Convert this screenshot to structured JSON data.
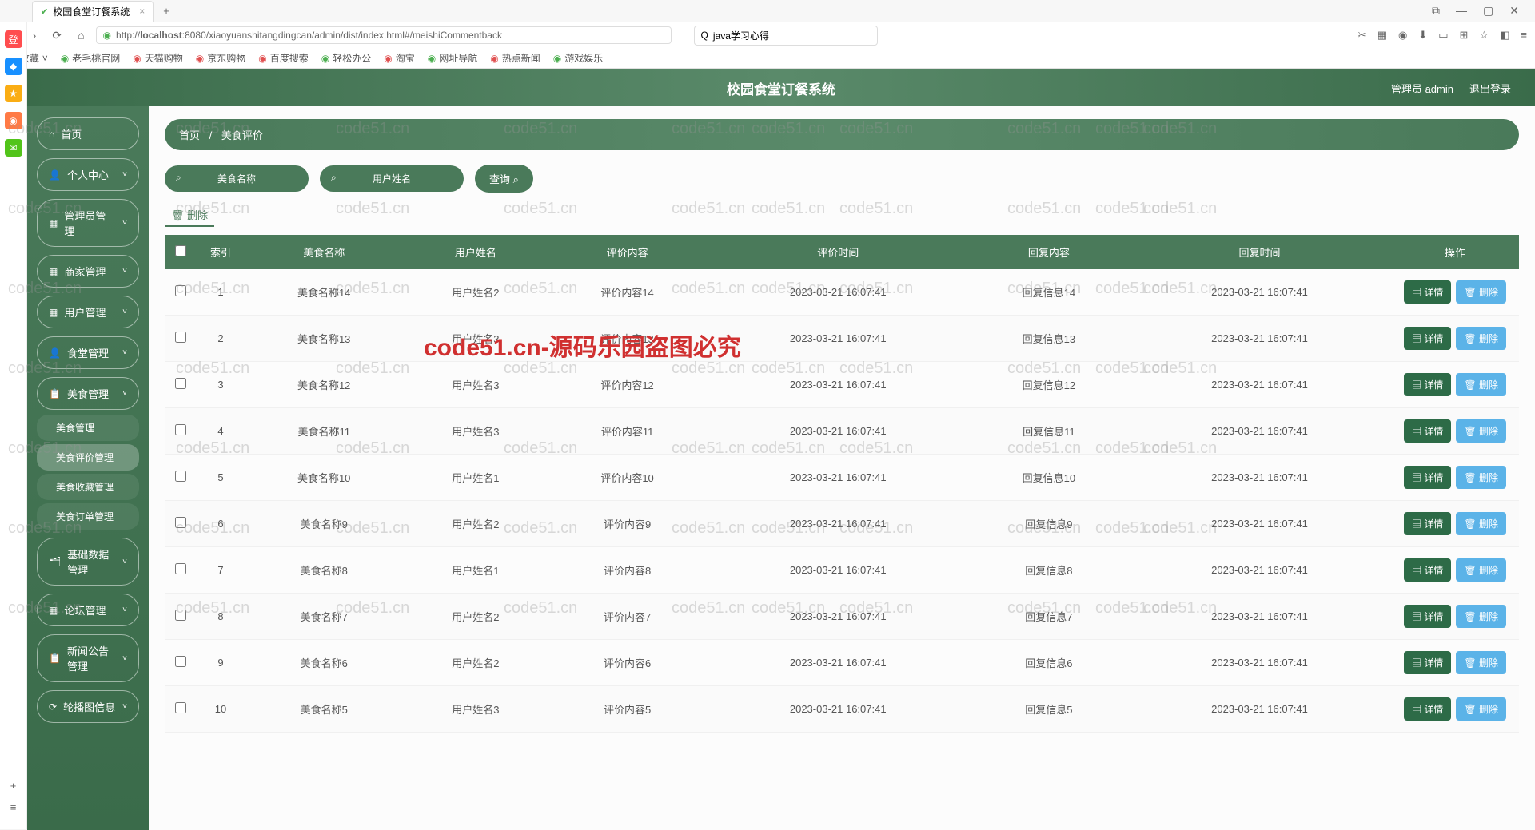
{
  "browser": {
    "tab_title": "校园食堂订餐系统",
    "url_prefix": "http://",
    "url_host": "localhost",
    "url_path": ":8080/xiaoyuanshitangdingcan/admin/dist/index.html#/meishiCommentback",
    "search_placeholder": "java学习心得",
    "bookmarks": [
      "收藏",
      "老毛桃官网",
      "天猫购物",
      "京东购物",
      "百度搜索",
      "轻松办公",
      "淘宝",
      "网址导航",
      "热点新闻",
      "游戏娱乐"
    ]
  },
  "header": {
    "title": "校园食堂订餐系统",
    "user": "管理员 admin",
    "logout": "退出登录"
  },
  "sidebar": {
    "home": "首页",
    "items": [
      {
        "icon": "👤",
        "label": "个人中心"
      },
      {
        "icon": "▦",
        "label": "管理员管理"
      },
      {
        "icon": "▦",
        "label": "商家管理"
      },
      {
        "icon": "▦",
        "label": "用户管理"
      },
      {
        "icon": "👤",
        "label": "食堂管理"
      },
      {
        "icon": "📋",
        "label": "美食管理"
      },
      {
        "icon": "🗂",
        "label": "基础数据管理"
      },
      {
        "icon": "▦",
        "label": "论坛管理"
      },
      {
        "icon": "📋",
        "label": "新闻公告管理"
      },
      {
        "icon": "⟳",
        "label": "轮播图信息"
      }
    ],
    "submenu": [
      "美食管理",
      "美食评价管理",
      "美食收藏管理",
      "美食订单管理"
    ]
  },
  "breadcrumb": {
    "home": "首页",
    "current": "美食评价"
  },
  "search": {
    "input1": "美食名称",
    "input2": "用户姓名",
    "query_btn": "查询",
    "batch_del": "删除"
  },
  "table": {
    "headers": [
      "索引",
      "美食名称",
      "用户姓名",
      "评价内容",
      "评价时间",
      "回复内容",
      "回复时间",
      "操作"
    ],
    "detail_btn": "详情",
    "delete_btn": "删除",
    "rows": [
      {
        "idx": "1",
        "name": "美食名称14",
        "user": "用户姓名2",
        "content": "评价内容14",
        "time": "2023-03-21 16:07:41",
        "reply": "回复信息14",
        "rtime": "2023-03-21 16:07:41"
      },
      {
        "idx": "2",
        "name": "美食名称13",
        "user": "用户姓名3",
        "content": "评价内容13",
        "time": "2023-03-21 16:07:41",
        "reply": "回复信息13",
        "rtime": "2023-03-21 16:07:41"
      },
      {
        "idx": "3",
        "name": "美食名称12",
        "user": "用户姓名3",
        "content": "评价内容12",
        "time": "2023-03-21 16:07:41",
        "reply": "回复信息12",
        "rtime": "2023-03-21 16:07:41"
      },
      {
        "idx": "4",
        "name": "美食名称11",
        "user": "用户姓名3",
        "content": "评价内容11",
        "time": "2023-03-21 16:07:41",
        "reply": "回复信息11",
        "rtime": "2023-03-21 16:07:41"
      },
      {
        "idx": "5",
        "name": "美食名称10",
        "user": "用户姓名1",
        "content": "评价内容10",
        "time": "2023-03-21 16:07:41",
        "reply": "回复信息10",
        "rtime": "2023-03-21 16:07:41"
      },
      {
        "idx": "6",
        "name": "美食名称9",
        "user": "用户姓名2",
        "content": "评价内容9",
        "time": "2023-03-21 16:07:41",
        "reply": "回复信息9",
        "rtime": "2023-03-21 16:07:41"
      },
      {
        "idx": "7",
        "name": "美食名称8",
        "user": "用户姓名1",
        "content": "评价内容8",
        "time": "2023-03-21 16:07:41",
        "reply": "回复信息8",
        "rtime": "2023-03-21 16:07:41"
      },
      {
        "idx": "8",
        "name": "美食名称7",
        "user": "用户姓名2",
        "content": "评价内容7",
        "time": "2023-03-21 16:07:41",
        "reply": "回复信息7",
        "rtime": "2023-03-21 16:07:41"
      },
      {
        "idx": "9",
        "name": "美食名称6",
        "user": "用户姓名2",
        "content": "评价内容6",
        "time": "2023-03-21 16:07:41",
        "reply": "回复信息6",
        "rtime": "2023-03-21 16:07:41"
      },
      {
        "idx": "10",
        "name": "美食名称5",
        "user": "用户姓名3",
        "content": "评价内容5",
        "time": "2023-03-21 16:07:41",
        "reply": "回复信息5",
        "rtime": "2023-03-21 16:07:41"
      }
    ]
  },
  "watermark": {
    "text": "code51.cn",
    "center": "code51.cn-源码乐园盗图必究"
  }
}
